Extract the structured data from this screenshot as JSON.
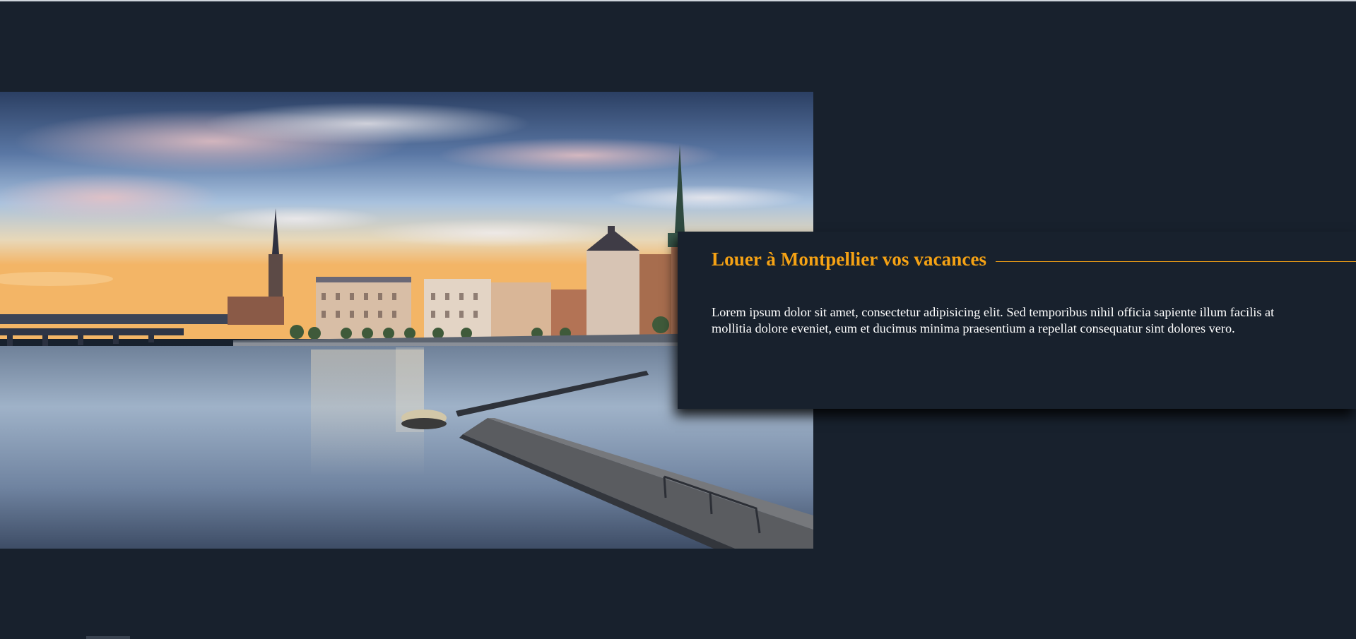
{
  "hero": {
    "alt": "Stockholm waterfront at dusk with a long pier"
  },
  "card": {
    "title": "Louer à Montpellier vos vacances",
    "body": "Lorem ipsum dolor sit amet, consectetur adipisicing elit. Sed temporibus nihil officia sapiente illum facilis at mollitia dolore eveniet, eum et ducimus minima praesentium a repellat consequatur sint dolores vero."
  },
  "colors": {
    "background": "#18212d",
    "accent": "#f5a214",
    "text": "#ffffff"
  }
}
